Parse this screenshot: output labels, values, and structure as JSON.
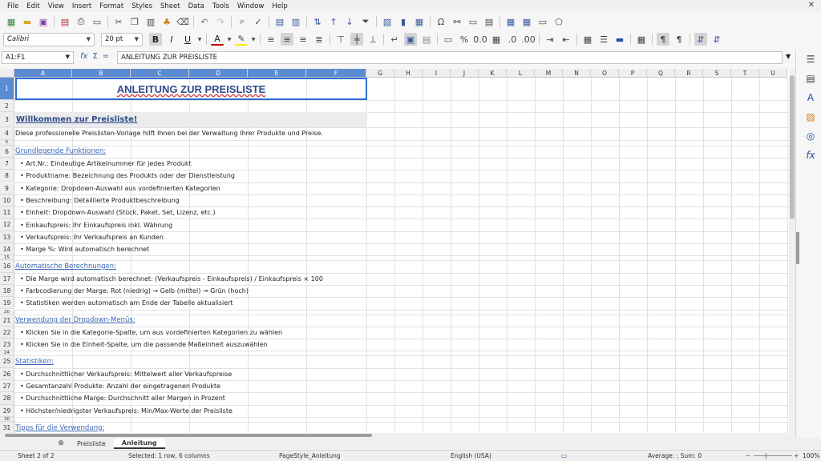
{
  "menu": [
    "File",
    "Edit",
    "View",
    "Insert",
    "Format",
    "Styles",
    "Sheet",
    "Data",
    "Tools",
    "Window",
    "Help"
  ],
  "toolbar": {
    "font_name": "Calibri",
    "font_size": "20 pt"
  },
  "formula_bar": {
    "name_box": "A1:F1",
    "fx": "fx",
    "sigma": "Σ",
    "equals": "=",
    "content": "ANLEITUNG ZUR PREISLISTE"
  },
  "columns": [
    "A",
    "B",
    "C",
    "D",
    "E",
    "F",
    "G",
    "H",
    "I",
    "J",
    "K",
    "L",
    "M",
    "N",
    "O",
    "P",
    "Q",
    "R",
    "S",
    "T",
    "U"
  ],
  "rows": [
    "1",
    "2",
    "3",
    "4",
    "5",
    "6",
    "7",
    "8",
    "9",
    "10",
    "11",
    "12",
    "13",
    "14",
    "15",
    "16",
    "17",
    "18",
    "19",
    "20",
    "21",
    "22",
    "23",
    "24",
    "25",
    "26",
    "27",
    "28",
    "29",
    "30",
    "31"
  ],
  "sheet": {
    "title": "ANLEITUNG ZUR PREISLISTE",
    "welcome": "Willkommen zur Preisliste!",
    "intro": "Diese professionelle Preislisten-Vorlage hilft Ihnen bei der Verwaltung Ihrer Produkte und Preise.",
    "sec_basic": "Grundlegende Funktionen:",
    "basic": [
      "• Art.Nr.: Eindeutige Artikelnummer für jedes Produkt",
      "• Produktname: Bezeichnung des Produkts oder der Dienstleistung",
      "• Kategorie: Dropdown-Auswahl aus vordefinierten Kategorien",
      "• Beschreibung: Detaillierte Produktbeschreibung",
      "• Einheit: Dropdown-Auswahl (Stück, Paket, Set, Lizenz, etc.)",
      "• Einkaufspreis: Ihr Einkaufspreis inkl. Währung",
      "• Verkaufspreis: Ihr Verkaufspreis an Kunden",
      "• Marge %: Wird automatisch berechnet"
    ],
    "sec_auto": "Automatische Berechnungen:",
    "auto": [
      "• Die Marge wird automatisch berechnet: (Verkaufspreis - Einkaufspreis) / Einkaufspreis × 100",
      "• Farbcodierung der Marge: Rot (niedrig) → Gelb (mittel) → Grün (hoch)",
      "• Statistiken werden automatisch am Ende der Tabelle aktualisiert"
    ],
    "sec_dropdown": "Verwendung der Dropdown-Menüs:",
    "dropdown": [
      "• Klicken Sie in die Kategorie-Spalte, um aus vordefinierten Kategorien zu wählen",
      "• Klicken Sie in die Einheit-Spalte, um die passende Maßeinheit auszuwählen"
    ],
    "sec_stats": "Statistiken:",
    "stats": [
      "• Durchschnittlicher Verkaufspreis: Mittelwert aller Verkaufspreise",
      "• Gesamtanzahl Produkte: Anzahl der eingetragenen Produkte",
      "• Durchschnittliche Marge: Durchschnitt aller Margen in Prozent",
      "• Höchster/niedrigster Verkaufspreis: Min/Max-Werte der Preisliste"
    ],
    "sec_tips": "Tipps für die Verwendung:"
  },
  "tabs": [
    "Preisliste",
    "Anleitung"
  ],
  "status": {
    "sheet": "Sheet 2 of 2",
    "selected": "Selected: 1 row, 6 columns",
    "pagestyle": "PageStyle_Anleitung",
    "language": "English (USA)",
    "sum": "Average: ; Sum: 0",
    "zoom": "100%"
  },
  "colors": {
    "selection": "#5b8bd0",
    "title": "#2e4a8a",
    "section": "#3b66b3"
  }
}
